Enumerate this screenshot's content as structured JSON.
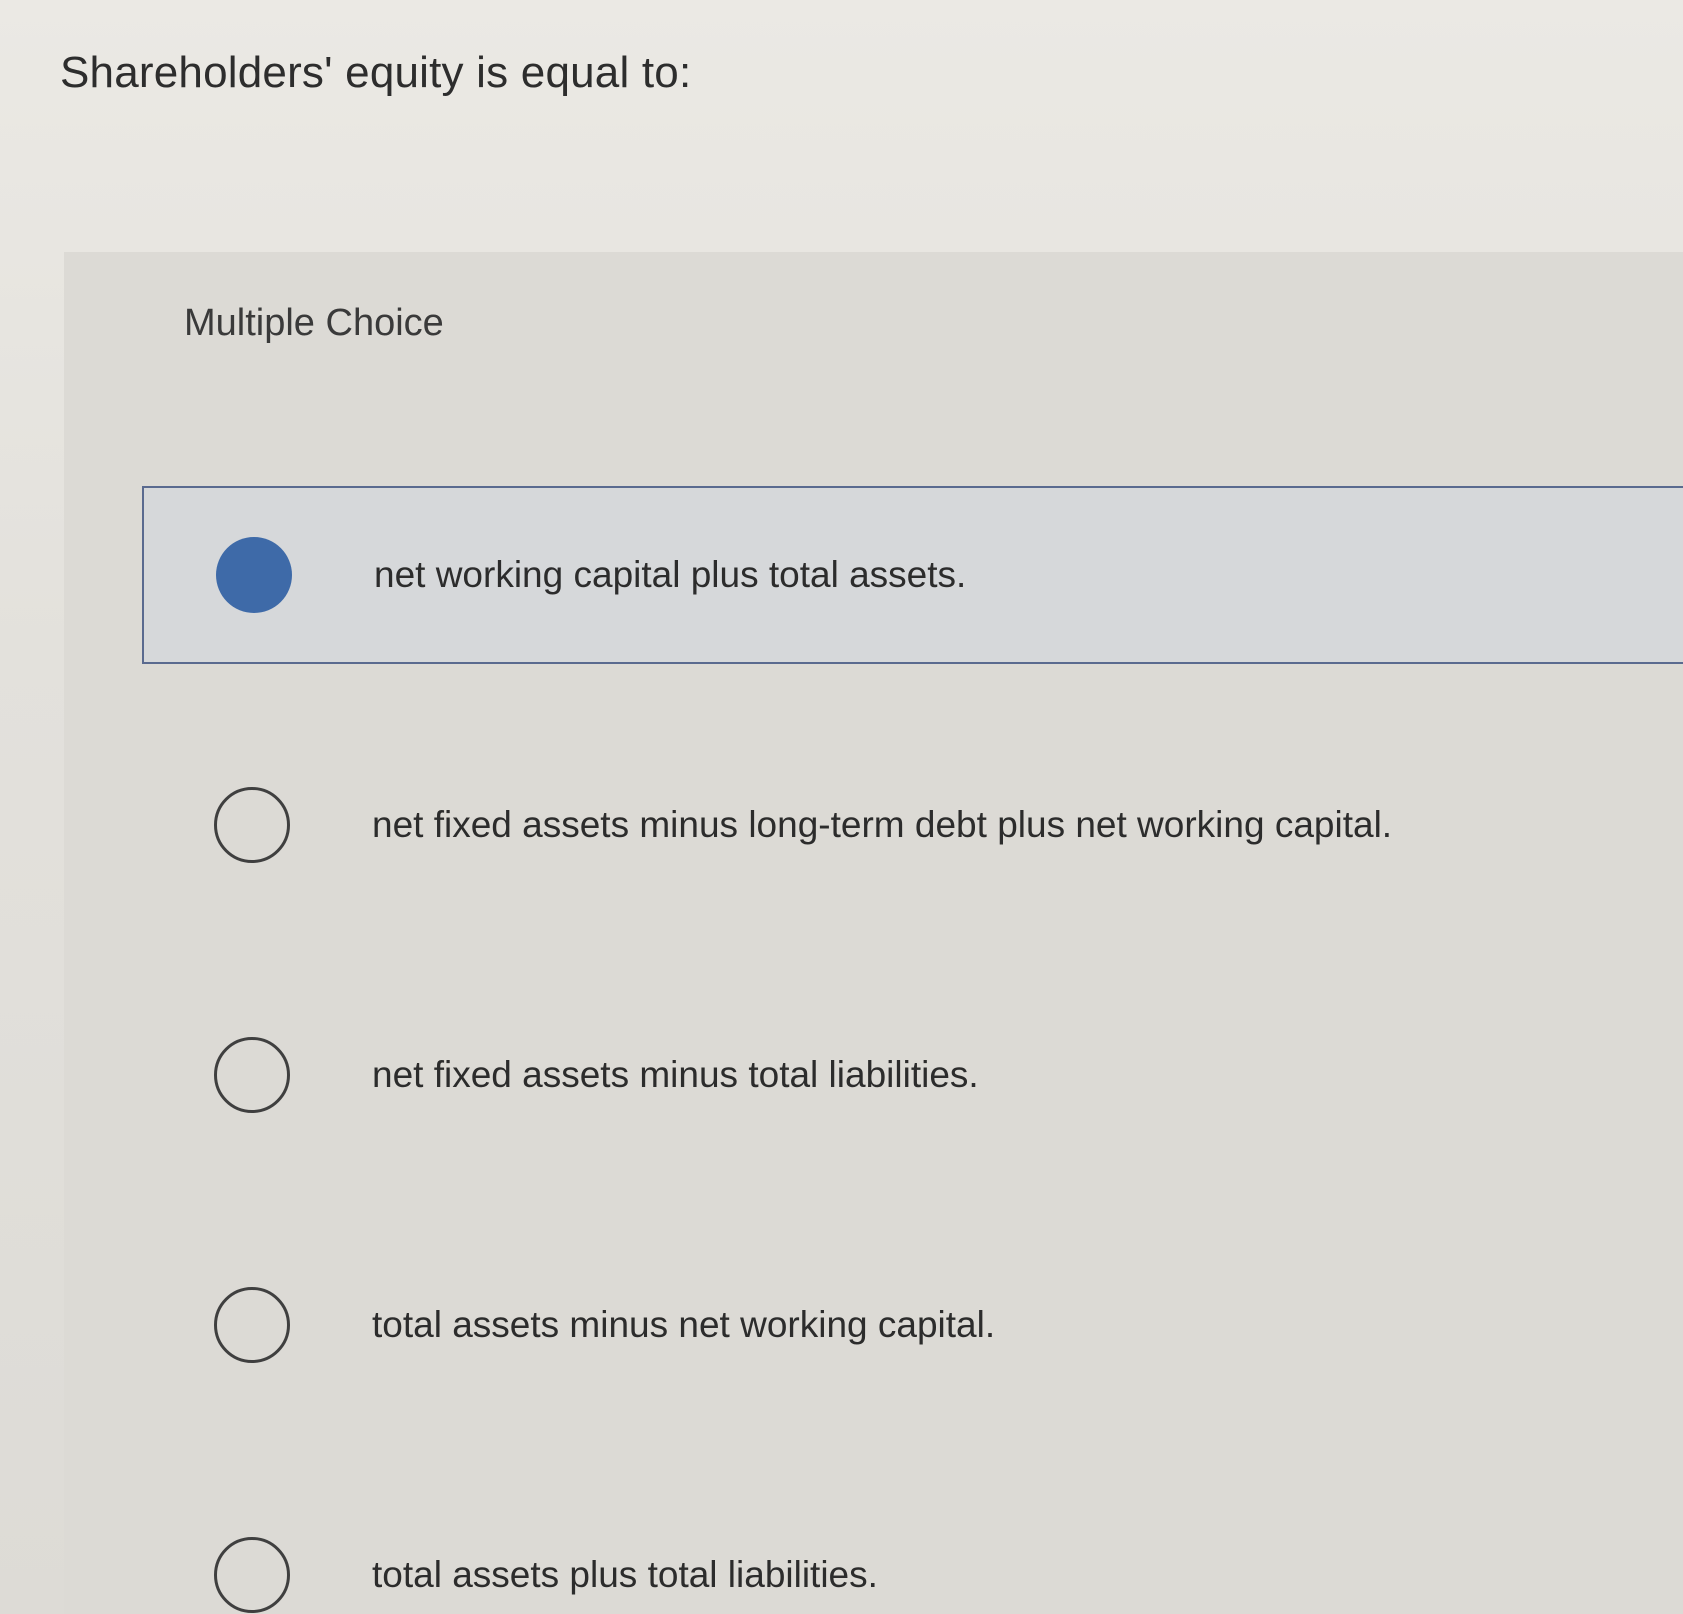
{
  "question": {
    "text": "Shareholders' equity is equal to:"
  },
  "panel": {
    "type_label": "Multiple Choice"
  },
  "options": [
    {
      "text": "net working capital plus total assets.",
      "selected": true
    },
    {
      "text": "net fixed assets minus long-term debt plus net working capital.",
      "selected": false
    },
    {
      "text": "net fixed assets minus total liabilities.",
      "selected": false
    },
    {
      "text": "total assets minus net working capital.",
      "selected": false
    },
    {
      "text": "total assets plus total liabilities.",
      "selected": false
    }
  ],
  "colors": {
    "selected_radio": "#3e6aa8",
    "selected_border": "#5a6a8f"
  }
}
